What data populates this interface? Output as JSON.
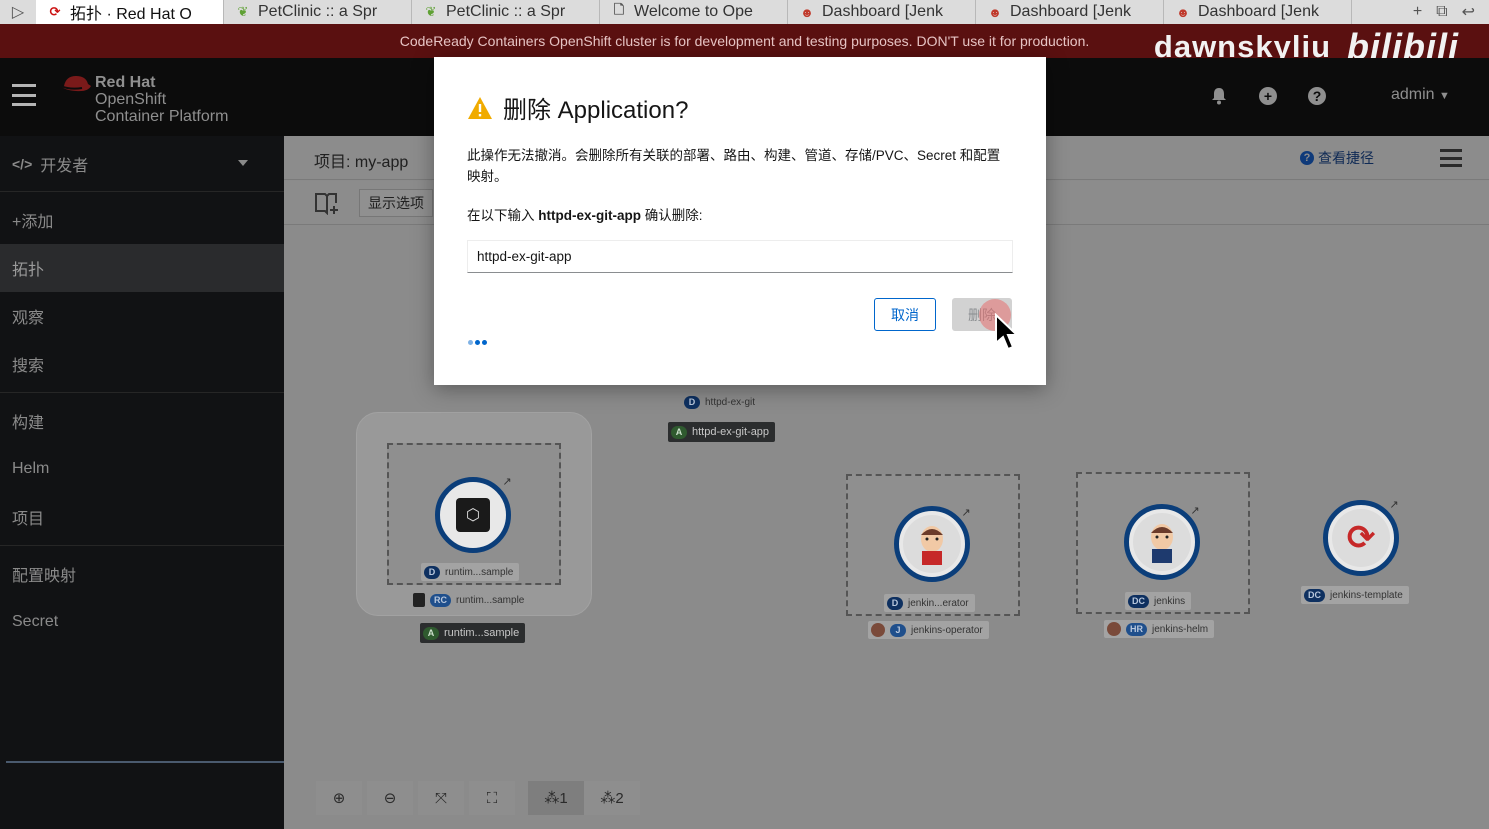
{
  "browser": {
    "nav_glyph": "▷",
    "tabs": [
      {
        "label": "拓扑 · Red Hat O",
        "icon": "openshift-icon",
        "color": "#cc1111"
      },
      {
        "label": "PetClinic :: a Spr",
        "icon": "spring-icon",
        "color": "#5fa134"
      },
      {
        "label": "PetClinic :: a Spr",
        "icon": "spring-icon",
        "color": "#5fa134"
      },
      {
        "label": "Welcome to Ope",
        "icon": "page-icon",
        "color": "#555555"
      },
      {
        "label": "Dashboard [Jenk",
        "icon": "jenkins-icon",
        "color": "#c0392b"
      },
      {
        "label": "Dashboard [Jenk",
        "icon": "jenkins-icon",
        "color": "#c0392b"
      },
      {
        "label": "Dashboard [Jenk",
        "icon": "jenkins-icon",
        "color": "#c0392b"
      }
    ],
    "actions": [
      "+",
      "⧉",
      "↩"
    ]
  },
  "banner": {
    "text": "CodeReady Containers OpenShift cluster is for development and testing purposes. DON'T use it for production."
  },
  "watermark": {
    "user": "dawnskyliu",
    "logo": "bilibili"
  },
  "masthead": {
    "brand_line1": "Red Hat",
    "brand_line2": "OpenShift",
    "brand_line3": "Container Platform",
    "user": "admin",
    "icons": [
      "bell-icon",
      "plus-circle-icon",
      "help-icon"
    ]
  },
  "sidebar": {
    "perspective": "开发者",
    "perspective_icon": "</>",
    "items": [
      {
        "label": "+添加",
        "active": false
      },
      {
        "label": "拓扑",
        "active": true
      },
      {
        "label": "观察",
        "active": false
      },
      {
        "label": "搜索",
        "active": false
      },
      {
        "label": "构建",
        "active": false
      },
      {
        "label": "Helm",
        "active": false
      },
      {
        "label": "项目",
        "active": false
      },
      {
        "label": "配置映射",
        "active": false
      },
      {
        "label": "Secret",
        "active": false
      }
    ]
  },
  "content": {
    "project": "项目: my-app",
    "shortcuts": "查看捷径",
    "display_options": "显示选项"
  },
  "topology": {
    "nodes": [
      {
        "name": "runtim...sample",
        "kind": "D",
        "sub": "runtim...sample",
        "sub_kind": "RC",
        "app": "runtim...sample",
        "app_kind": "A"
      },
      {
        "name": "httpd-ex-git",
        "kind": "D",
        "app": "httpd-ex-git-app",
        "app_kind": "A"
      },
      {
        "name": "jenkin...erator",
        "kind": "D",
        "sub": "jenkins-operator",
        "sub_kind": "J"
      },
      {
        "name": "jenkins",
        "kind": "DC",
        "sub": "jenkins-helm",
        "sub_kind": "HR"
      },
      {
        "name": "jenkins-template",
        "kind": "DC"
      }
    ]
  },
  "zoom": {
    "buttons": [
      "zoom-in-icon",
      "zoom-out-icon",
      "fit-icon",
      "reset-icon"
    ],
    "layout1": "1",
    "layout2": "2"
  },
  "modal": {
    "title": "删除 Application?",
    "description": "此操作无法撤消。会删除所有关联的部署、路由、构建、管道、存储/PVC、Secret 和配置映射。",
    "confirm_prefix": "在以下输入 ",
    "confirm_name": "httpd-ex-git-app",
    "confirm_suffix": " 确认删除:",
    "input_value": "httpd-ex-git-app",
    "cancel": "取消",
    "delete": "删除"
  },
  "colors": {
    "danger_banner": "#5a1010",
    "primary": "#0066cc",
    "warning": "#f0ab00",
    "node_ring": "#0b3e7a"
  }
}
